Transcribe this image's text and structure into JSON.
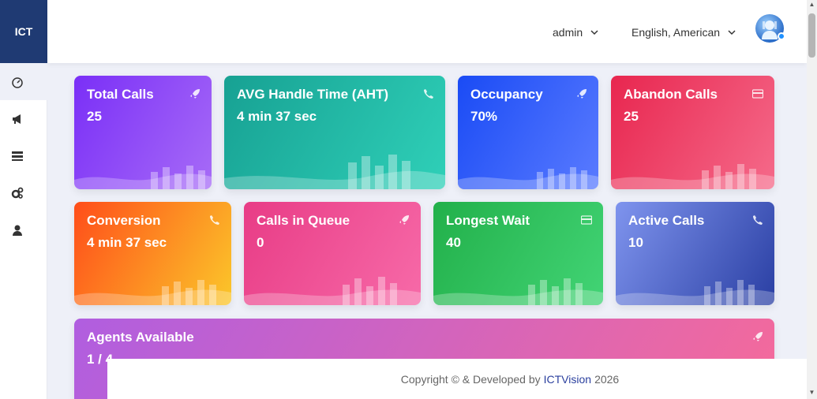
{
  "app": {
    "logo": "ICT"
  },
  "header": {
    "user_label": "admin",
    "language_label": "English, American"
  },
  "sidebar": {
    "items": [
      {
        "icon": "dashboard-icon"
      },
      {
        "icon": "megaphone-icon"
      },
      {
        "icon": "list-icon"
      },
      {
        "icon": "gears-icon"
      },
      {
        "icon": "user-icon"
      }
    ]
  },
  "cards": [
    {
      "title": "Total Calls",
      "value": "25",
      "icon": "rocket-icon",
      "gradient": [
        "#7a2ff7",
        "#a76bf7"
      ]
    },
    {
      "title": "AVG Handle Time (AHT)",
      "value": "4 min 37 sec",
      "icon": "phone-icon",
      "gradient": [
        "#17a193",
        "#2fd0b8"
      ]
    },
    {
      "title": "Occupancy",
      "value": "70%",
      "icon": "rocket-icon",
      "gradient": [
        "#1a4bf5",
        "#5a7bff"
      ]
    },
    {
      "title": "Abandon Calls",
      "value": "25",
      "icon": "card-icon",
      "gradient": [
        "#e8264f",
        "#f56a8a"
      ]
    },
    {
      "title": "Conversion",
      "value": "4 min 37 sec",
      "icon": "phone-icon",
      "gradient": [
        "#ff4d1a",
        "#fbc72a"
      ]
    },
    {
      "title": "Calls in Queue",
      "value": "0",
      "icon": "rocket-icon",
      "gradient": [
        "#e83c86",
        "#f76aa8"
      ]
    },
    {
      "title": "Longest Wait",
      "value": "40",
      "icon": "card-icon",
      "gradient": [
        "#22b04a",
        "#42d475"
      ]
    },
    {
      "title": "Active Calls",
      "value": "10",
      "icon": "phone-icon",
      "gradient": [
        "#7f94ee",
        "#2a3fa3"
      ]
    },
    {
      "title": "Agents Available",
      "value": "1 / 4",
      "icon": "rocket-icon",
      "gradient": [
        "#b05ee0",
        "#f56a9a"
      ]
    }
  ],
  "footer": {
    "prefix": "Copyright © & Developed by",
    "brand": "ICTVision",
    "year": "2026"
  }
}
